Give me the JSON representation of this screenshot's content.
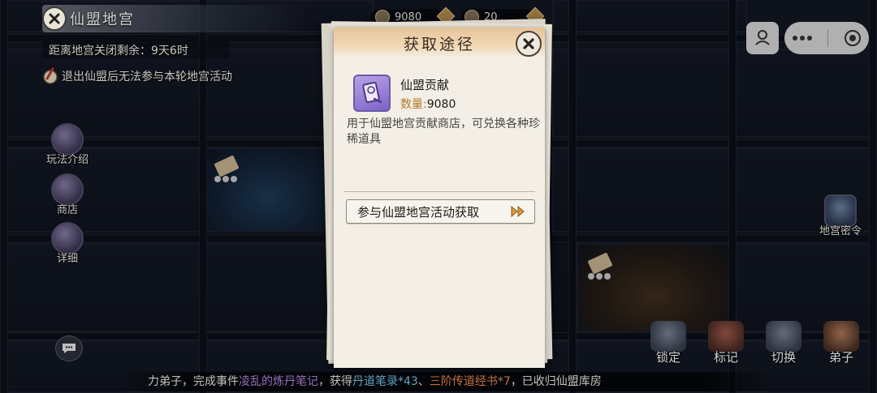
{
  "header": {
    "title": "仙盟地宫",
    "countdown_label": "距离地宫关闭剩余：9天6时",
    "notice": "退出仙盟后无法参与本轮地宫活动"
  },
  "currency": {
    "contribution": "9080",
    "second": "20"
  },
  "side_menu": {
    "rules": "玩法介绍",
    "shop": "商店",
    "details": "详细"
  },
  "right_menu": {
    "secret": "地宫密令"
  },
  "bottom_actions": {
    "lock": "锁定",
    "mark": "标记",
    "switch": "切换",
    "disciple": "弟子"
  },
  "ticker": {
    "p1": "力弟子，完成事件",
    "p2": "凌乱的炼丹笔记",
    "p3": "，获得",
    "p4": "丹道笔录*43",
    "p5": "、",
    "p6": "三阶传道经书*7",
    "p7": "，已收归仙盟库房"
  },
  "modal": {
    "title": "获取途径",
    "item_name": "仙盟贡献",
    "qty_label": "数量:",
    "qty_value": "9080",
    "description": "用于仙盟地宫贡献商店，可兑换各种珍稀道具",
    "source_button": "参与仙盟地宫活动获取"
  },
  "colors": {
    "accent_gold": "#b5772b",
    "item_purple": "#9b80d8",
    "ticker_purple": "#b985e6",
    "ticker_blue": "#78c7ec",
    "ticker_orange": "#f08a4a"
  }
}
